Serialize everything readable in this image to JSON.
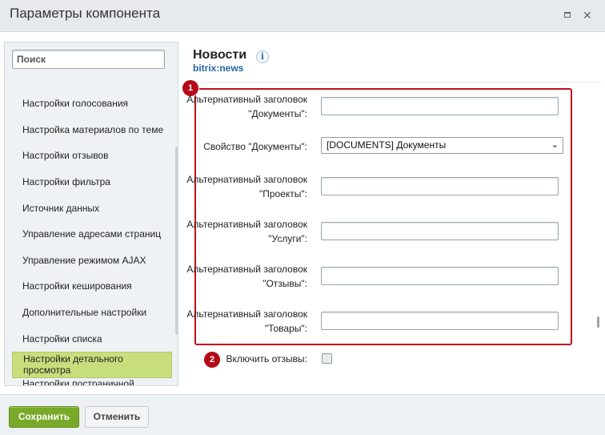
{
  "window": {
    "title": "Параметры компонента",
    "maximize_icon": "maximize-icon",
    "close_icon": "close-icon"
  },
  "sidebar": {
    "search_placeholder": "Поиск",
    "items": [
      {
        "label": "Настройки голосования"
      },
      {
        "label": "Настройка материалов по теме"
      },
      {
        "label": "Настройки отзывов"
      },
      {
        "label": "Настройки фильтра"
      },
      {
        "label": "Источник данных"
      },
      {
        "label": "Управление адресами страниц"
      },
      {
        "label": "Управление режимом AJAX"
      },
      {
        "label": "Настройки кеширования"
      },
      {
        "label": "Дополнительные настройки"
      },
      {
        "label": "Настройки списка"
      },
      {
        "label": "Настройки детального просмотра",
        "active": true
      },
      {
        "label": "Настройки постраничной навигации"
      }
    ]
  },
  "component": {
    "title": "Новости",
    "code": "bitrix:news",
    "info_icon": "i"
  },
  "badges": {
    "first": "1",
    "second": "2"
  },
  "fields": [
    {
      "label": "Альтернативный заголовок \"Документы\":",
      "type": "text",
      "value": ""
    },
    {
      "label": "Свойство \"Документы\":",
      "type": "select",
      "value": "[DOCUMENTS] Документы"
    },
    {
      "label": "Альтернативный заголовок \"Проекты\":",
      "type": "text",
      "value": ""
    },
    {
      "label": "Альтернативный заголовок \"Услуги\":",
      "type": "text",
      "value": ""
    },
    {
      "label": "Альтернативный заголовок \"Отзывы\":",
      "type": "text",
      "value": ""
    },
    {
      "label": "Альтернативный заголовок \"Товары\":",
      "type": "text",
      "value": ""
    }
  ],
  "reviews_toggle": {
    "label": "Включить отзывы:",
    "checked": false
  },
  "colors": {
    "highlight": "#c20d1d",
    "save_button": "#79a929",
    "active_item": "#c8de7c",
    "link": "#2367a8"
  },
  "footer": {
    "save_label": "Сохранить",
    "cancel_label": "Отменить"
  }
}
